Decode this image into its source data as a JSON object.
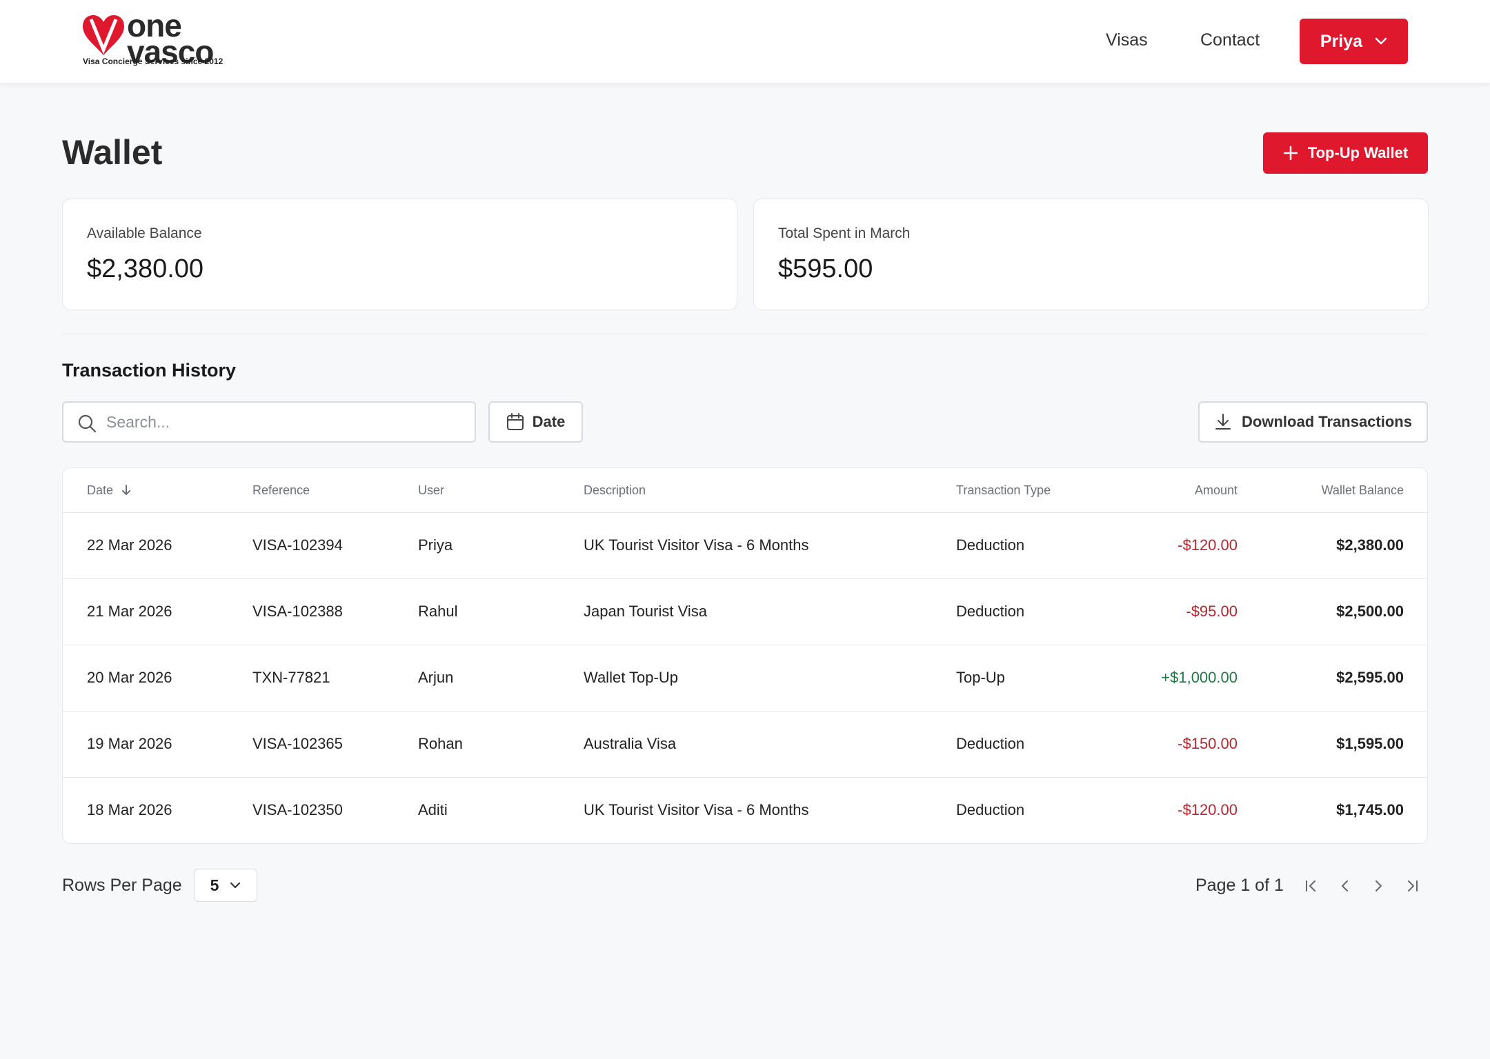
{
  "brand": {
    "line1": "one",
    "line2": "vasco",
    "tagline": "Visa Concierge Services since 2012",
    "color": "#e0182d"
  },
  "nav": {
    "links": [
      "Visas",
      "Contact"
    ],
    "user_label": "Priya",
    "user_icon": "chevron-down-icon"
  },
  "page": {
    "title": "Wallet",
    "topup_label": "Top-Up Wallet",
    "topup_icon": "plus-icon"
  },
  "cards": [
    {
      "label": "Available Balance",
      "value": "$2,380.00"
    },
    {
      "label": "Total Spent in March",
      "value": "$595.00"
    }
  ],
  "history": {
    "title": "Transaction History",
    "search_placeholder": "Search...",
    "date_label": "Date",
    "download_label": "Download Transactions",
    "columns": [
      "Date",
      "Reference",
      "User",
      "Description",
      "Transaction Type",
      "Amount",
      "Wallet Balance"
    ],
    "sort_icon": "arrow-down-icon",
    "rows": [
      {
        "date": "22 Mar 2026",
        "reference": "VISA-102394",
        "user": "Priya",
        "description": "UK Tourist Visitor Visa - 6 Months",
        "type": "Deduction",
        "amount": "-$120.00",
        "balance": "$2,380.00"
      },
      {
        "date": "21 Mar 2026",
        "reference": "VISA-102388",
        "user": "Rahul",
        "description": "Japan Tourist Visa",
        "type": "Deduction",
        "amount": "-$95.00",
        "balance": "$2,500.00"
      },
      {
        "date": "20 Mar 2026",
        "reference": "TXN-77821",
        "user": "Arjun",
        "description": "Wallet Top-Up",
        "type": "Top-Up",
        "amount": "+$1,000.00",
        "balance": "$2,595.00"
      },
      {
        "date": "19 Mar 2026",
        "reference": "VISA-102365",
        "user": "Rohan",
        "description": "Australia Visa",
        "type": "Deduction",
        "amount": "-$150.00",
        "balance": "$1,595.00"
      },
      {
        "date": "18 Mar 2026",
        "reference": "VISA-102350",
        "user": "Aditi",
        "description": "UK Tourist Visitor Visa - 6 Months",
        "type": "Deduction",
        "amount": "-$120.00",
        "balance": "$1,745.00"
      }
    ]
  },
  "pagination": {
    "rows_per_page_label": "Rows Per Page",
    "rows_per_page_value": "5",
    "page_info": "Page 1 of 1"
  },
  "colors": {
    "accent": "#e0182d",
    "negative": "#b2282e",
    "positive": "#1f7a45"
  }
}
